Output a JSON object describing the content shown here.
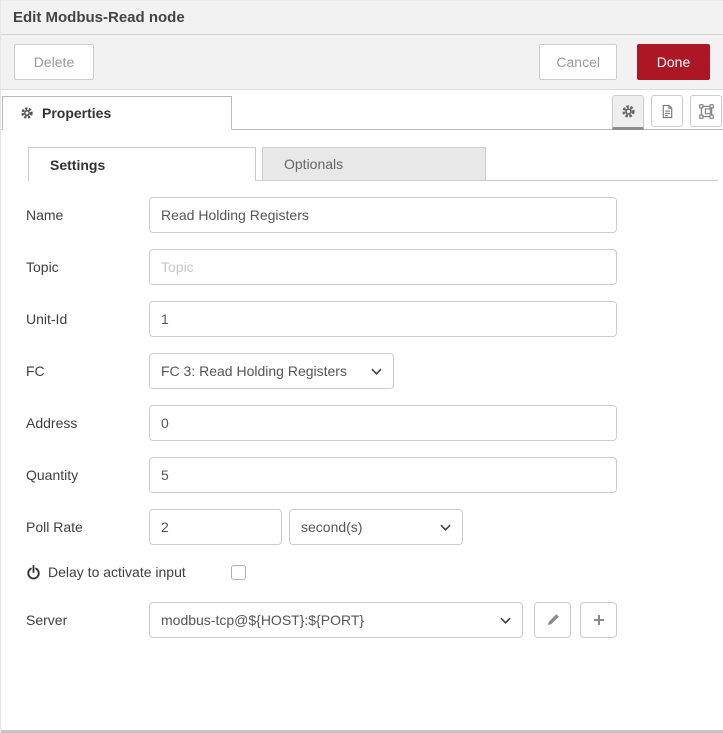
{
  "dialog": {
    "title": "Edit Modbus-Read node"
  },
  "toolbar": {
    "delete_label": "Delete",
    "cancel_label": "Cancel",
    "done_label": "Done"
  },
  "editor_tabs": {
    "properties_label": "Properties",
    "icon_buttons": [
      "gear-icon",
      "document-icon",
      "appearance-icon"
    ]
  },
  "sub_tabs": {
    "settings_label": "Settings",
    "optionals_label": "Optionals"
  },
  "form": {
    "name": {
      "label": "Name",
      "value": "Read Holding Registers"
    },
    "topic": {
      "label": "Topic",
      "placeholder": "Topic"
    },
    "unit_id": {
      "label": "Unit-Id",
      "value": "1"
    },
    "fc": {
      "label": "FC",
      "selected": "FC 3: Read Holding Registers"
    },
    "address": {
      "label": "Address",
      "value": "0"
    },
    "quantity": {
      "label": "Quantity",
      "value": "5"
    },
    "poll_rate": {
      "label": "Poll Rate",
      "value": "2",
      "unit_selected": "second(s)"
    },
    "delay": {
      "label": "Delay to activate input",
      "checked": false
    },
    "server": {
      "label": "Server",
      "selected": "modbus-tcp@${HOST}:${PORT}"
    }
  },
  "colors": {
    "accent": "#AD1625",
    "header_bg": "#f2f2f2"
  }
}
